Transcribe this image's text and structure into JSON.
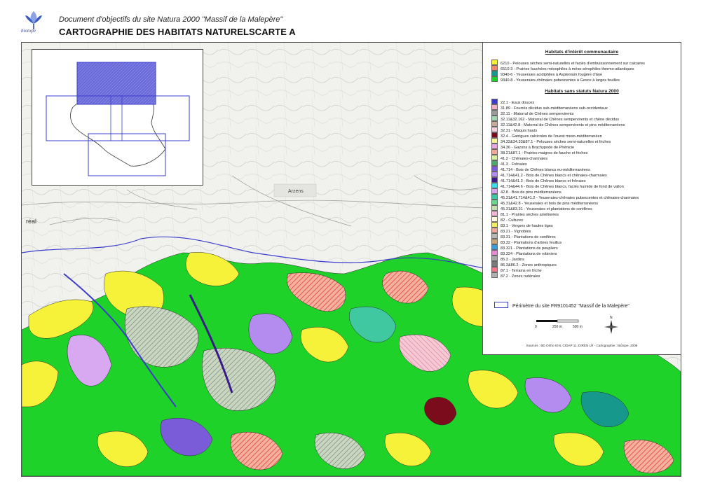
{
  "header": {
    "logo_text": "biotope",
    "doc_title": "Document d'objectifs du site Natura 2000 \"Massif de la Malepère\"",
    "main_title": "CARTOGRAPHIE DES HABITATS NATURELSCARTE A"
  },
  "map": {
    "place_label": "Arzens",
    "edge_label": "réal"
  },
  "legend": {
    "section1_title": "Habitats d'intérêt communautaire",
    "section1_items": [
      {
        "label": "6210 - Pelouses sèches semi-naturelles et faciès d'embuissonnement sur calcaires",
        "color": "#f6f23a"
      },
      {
        "label": "6510-3 - Prairies fauchées mésophiles à méso-xérophiles thermo-atlantiques",
        "color": "#f08a6e"
      },
      {
        "label": "9340-6 - Yeuseraies acidiphiles à Asplenium fougère d'âne",
        "color": "#16988c"
      },
      {
        "label": "9340-8 - Yeuseraies-chênaies pubescentes à Gesce à larges feuilles",
        "color": "#1ed22a"
      }
    ],
    "section2_title": "Habitats sans statuts Natura 2000",
    "section2_items": [
      {
        "label": "22.1 - Eaux douces",
        "color": "#3c3cc8"
      },
      {
        "label": "31.89 - Fourrés décidus sub-méditerranéens sub-occidentaux",
        "color": "#f3b2c8"
      },
      {
        "label": "32.11 - Matorral de Chênes sempervirents",
        "color": "#9a9a9a"
      },
      {
        "label": "32.11&32.162 - Matorral de Chênes sempervirents et chêne décidus",
        "color": "#a6d6b0"
      },
      {
        "label": "32.11&42.8 - Matorral de Chênes sempervirents et pins méditerranéens",
        "color": "#c8a89a"
      },
      {
        "label": "32.31 - Maquis hauts",
        "color": "#f2d0dc"
      },
      {
        "label": "32.4 - Garrigues calcicoles de l'ouest meso-méditerranéen",
        "color": "#7a0c1c"
      },
      {
        "label": "34.32&34.33&87.1 - Pelouses sèches semi-naturelles et friches",
        "color": "#f8f39a"
      },
      {
        "label": "34.36 - Gazons à Brachypode de Phénicie",
        "color": "#e8a8e0"
      },
      {
        "label": "38.21&87.1 - Prairies maigres de fauche et friches",
        "color": "#f4a89a"
      },
      {
        "label": "41.2 - Chênaies-charmaies",
        "color": "#d6f0a0"
      },
      {
        "label": "41.3 - Frênaies",
        "color": "#4caa6e"
      },
      {
        "label": "41.714 - Bois de Chênes blancs eu-méditerranéens",
        "color": "#7a5cd8"
      },
      {
        "label": "41.714&41.2 - Bois de Chênes blancs et chênaies-charmaies",
        "color": "#b48cf0"
      },
      {
        "label": "41.714&41.3 - Bois de Chênes blancs et frênaies",
        "color": "#3a1a88"
      },
      {
        "label": "41.714&44.6 - Bois de Chênes blancs, faciès humide de fond de vallon",
        "color": "#3ce0e8"
      },
      {
        "label": "42.8 - Bois de pins méditerranéens",
        "color": "#d8a8f0"
      },
      {
        "label": "45.31&41.714&41.2 - Yeuseraies-chênaies pubescentes et chênaies-charmaies",
        "color": "#40c8a0"
      },
      {
        "label": "45.31&42.8 - Yeuseraies et bois de pins méditerranéens",
        "color": "#6cd88c"
      },
      {
        "label": "45.31&83.31 - Yeuseraies et plantations de conifères",
        "color": "#c8e0b0"
      },
      {
        "label": "81.1 - Prairies sèches améliorées",
        "color": "#f6b6d6"
      },
      {
        "label": "82 - Cultures",
        "color": "#fffce0"
      },
      {
        "label": "83.1 - Vergers de hautes tiges",
        "color": "#f6ec6a"
      },
      {
        "label": "83.21 - Vignobles",
        "color": "#f0a898"
      },
      {
        "label": "83.31 - Plantations de conifères",
        "color": "#b8b8b8"
      },
      {
        "label": "83.32 - Plantations d'arbres feuillus",
        "color": "#c8a878"
      },
      {
        "label": "83.321 - Plantations de peupliers",
        "color": "#3c9cd8"
      },
      {
        "label": "83.324 - Plantations de robiniers",
        "color": "#e88ad8"
      },
      {
        "label": "85.3 - Jardins",
        "color": "#a8a8a8"
      },
      {
        "label": "86.3&86.2 - Zones anthropiques",
        "color": "#7a7a7a"
      },
      {
        "label": "87.1 - Terrains en friche",
        "color": "#f07a8a"
      },
      {
        "label": "87.2 - Zones rudérales",
        "color": "#b0b0b0"
      }
    ],
    "perimeter_label": "Périmètre du site FR9101452 \"Massif de la Malepère\"",
    "scale": {
      "zero": "0",
      "mid": "250 m",
      "end": "500 m"
    },
    "north_label": "N",
    "sources": "Sources : BD Ortho IGN, CIDAP 11, DIREN LR - Cartographie : Biotope, 2008"
  }
}
